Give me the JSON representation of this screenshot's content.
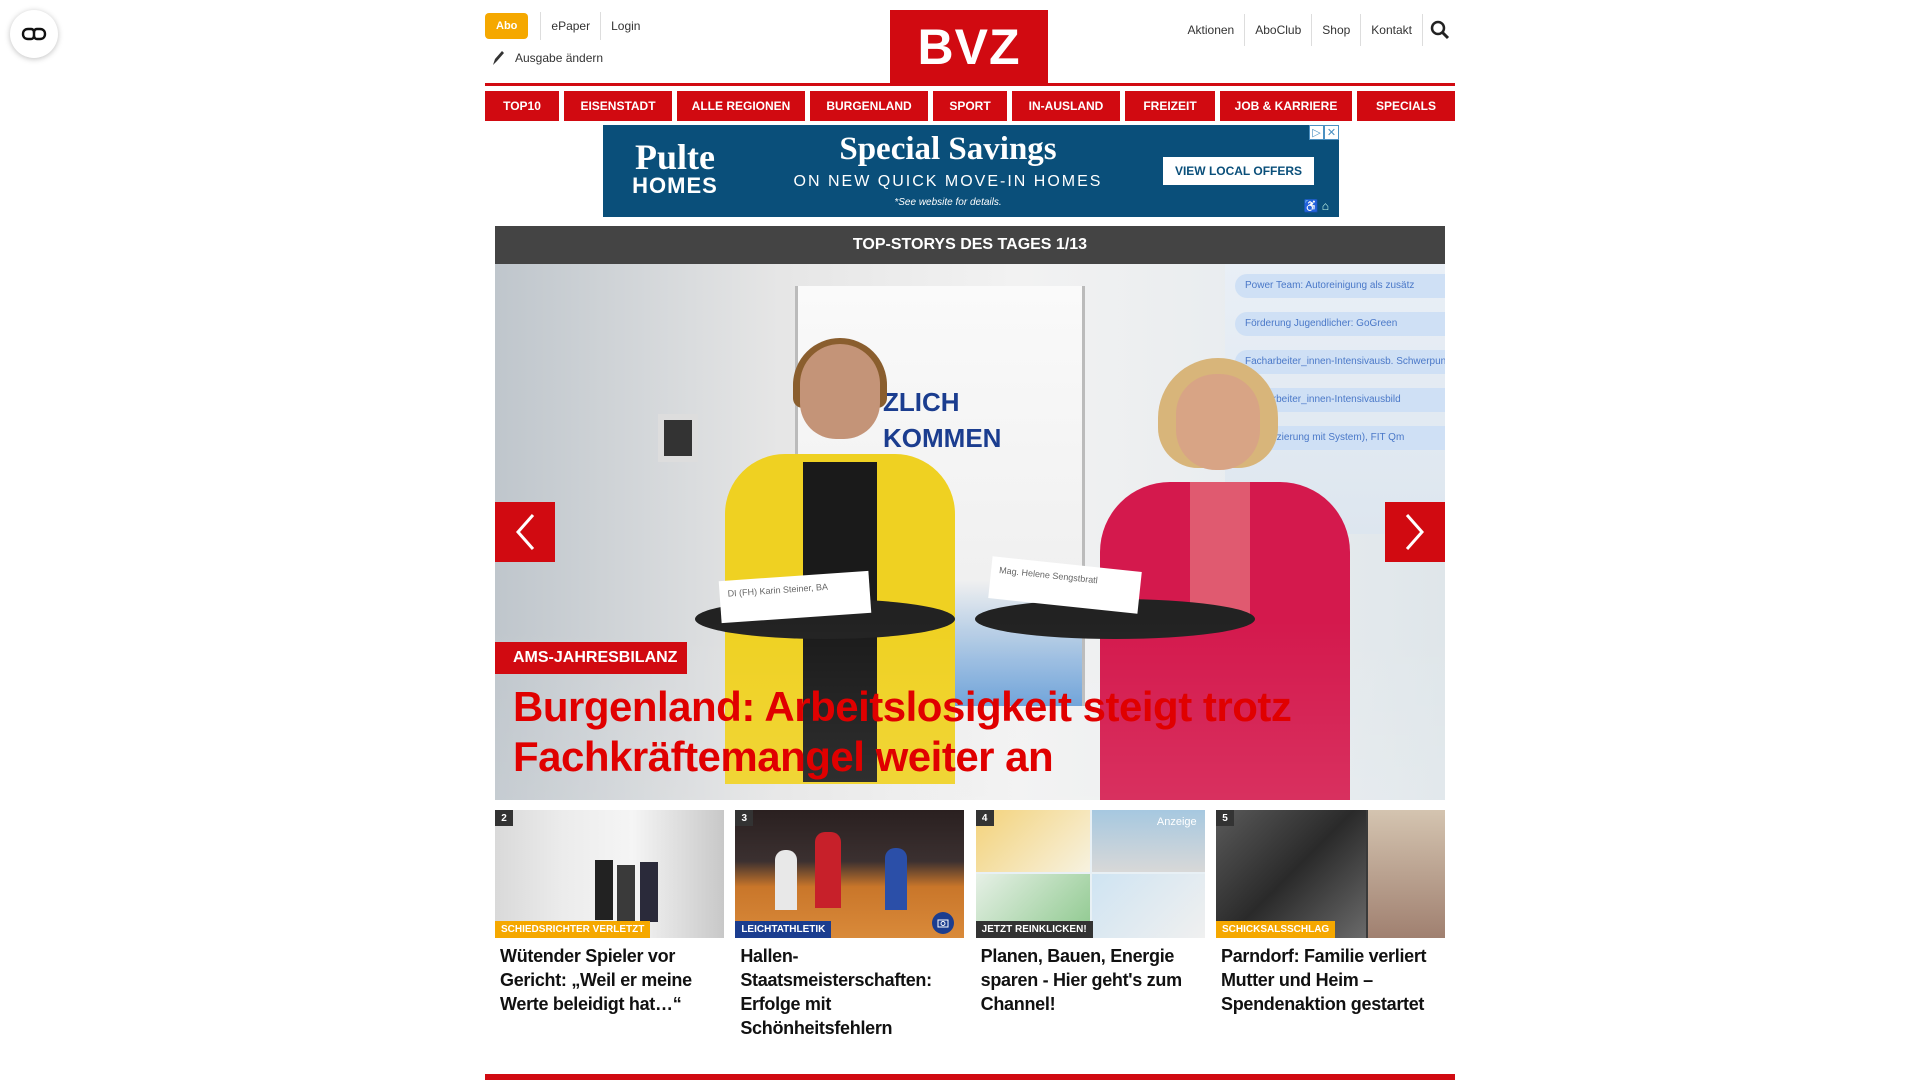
{
  "header": {
    "abo_label": "Abo",
    "links_left": [
      "ePaper",
      "Login"
    ],
    "ausgabe_label": "Ausgabe ändern",
    "logo": "BVZ",
    "links_right": [
      "Aktionen",
      "AboClub",
      "Shop",
      "Kontakt"
    ],
    "brand_color": "#d10a11"
  },
  "nav": {
    "items": [
      "TOP10",
      "EISENSTADT",
      "ALLE REGIONEN",
      "BURGENLAND",
      "SPORT",
      "IN-AUSLAND",
      "FREIZEIT",
      "JOB & KARRIERE",
      "SPECIALS"
    ]
  },
  "ad": {
    "brand_line1": "Pulte",
    "brand_line2": "HOMES",
    "headline": "Special Savings",
    "subline": "ON NEW QUICK MOVE-IN HOMES",
    "fine_print": "*See website for details.",
    "cta": "VIEW LOCAL OFFERS"
  },
  "slider": {
    "header": "TOP-STORYS DES TAGES 1/13",
    "banner_text_1": "ZLICH",
    "banner_text_2": "KOMMEN",
    "card_1": "DI (FH) Karin Steiner, BA",
    "card_2": "Mag. Helene Sengstbratl",
    "screen_items": [
      "Power Team: Autoreinigung als zusätz",
      "Förderung Jugendlicher: GoGreen",
      "Facharbeiter_innen-Intensivausb. Schwerpunkt: Sportartikel",
      "Facharbeiter_innen-Intensivausbild",
      "(Qualifizierung mit System), FIT Qm"
    ],
    "kicker": "AMS-JAHRESBILANZ",
    "headline": "Burgenland: Arbeitslosigkeit steigt trotz Fachkräftemangel weiter an"
  },
  "teasers": [
    {
      "num": "2",
      "kicker": "SCHIEDSRICHTER VERLETZT",
      "kicker_color": "#f5a800",
      "title": "Wütender Spieler vor Gericht: „Weil er meine Werte beleidigt hat…“"
    },
    {
      "num": "3",
      "kicker": "LEICHTATHLETIK",
      "kicker_color": "#1b3d8f",
      "title": "Hallen-Staatsmeisterschaften: Erfolge mit Schönheitsfehlern"
    },
    {
      "num": "4",
      "kicker": "JETZT REINKLICKEN!",
      "kicker_color": "#333333",
      "badge": "Anzeige",
      "title": "Planen, Bauen, Energie sparen - Hier geht's zum Channel!"
    },
    {
      "num": "5",
      "kicker": "SCHICKSALSSCHLAG",
      "kicker_color": "#f5a800",
      "title": "Parndorf: Familie verliert Mutter und Heim – Spendenaktion gestartet"
    }
  ]
}
